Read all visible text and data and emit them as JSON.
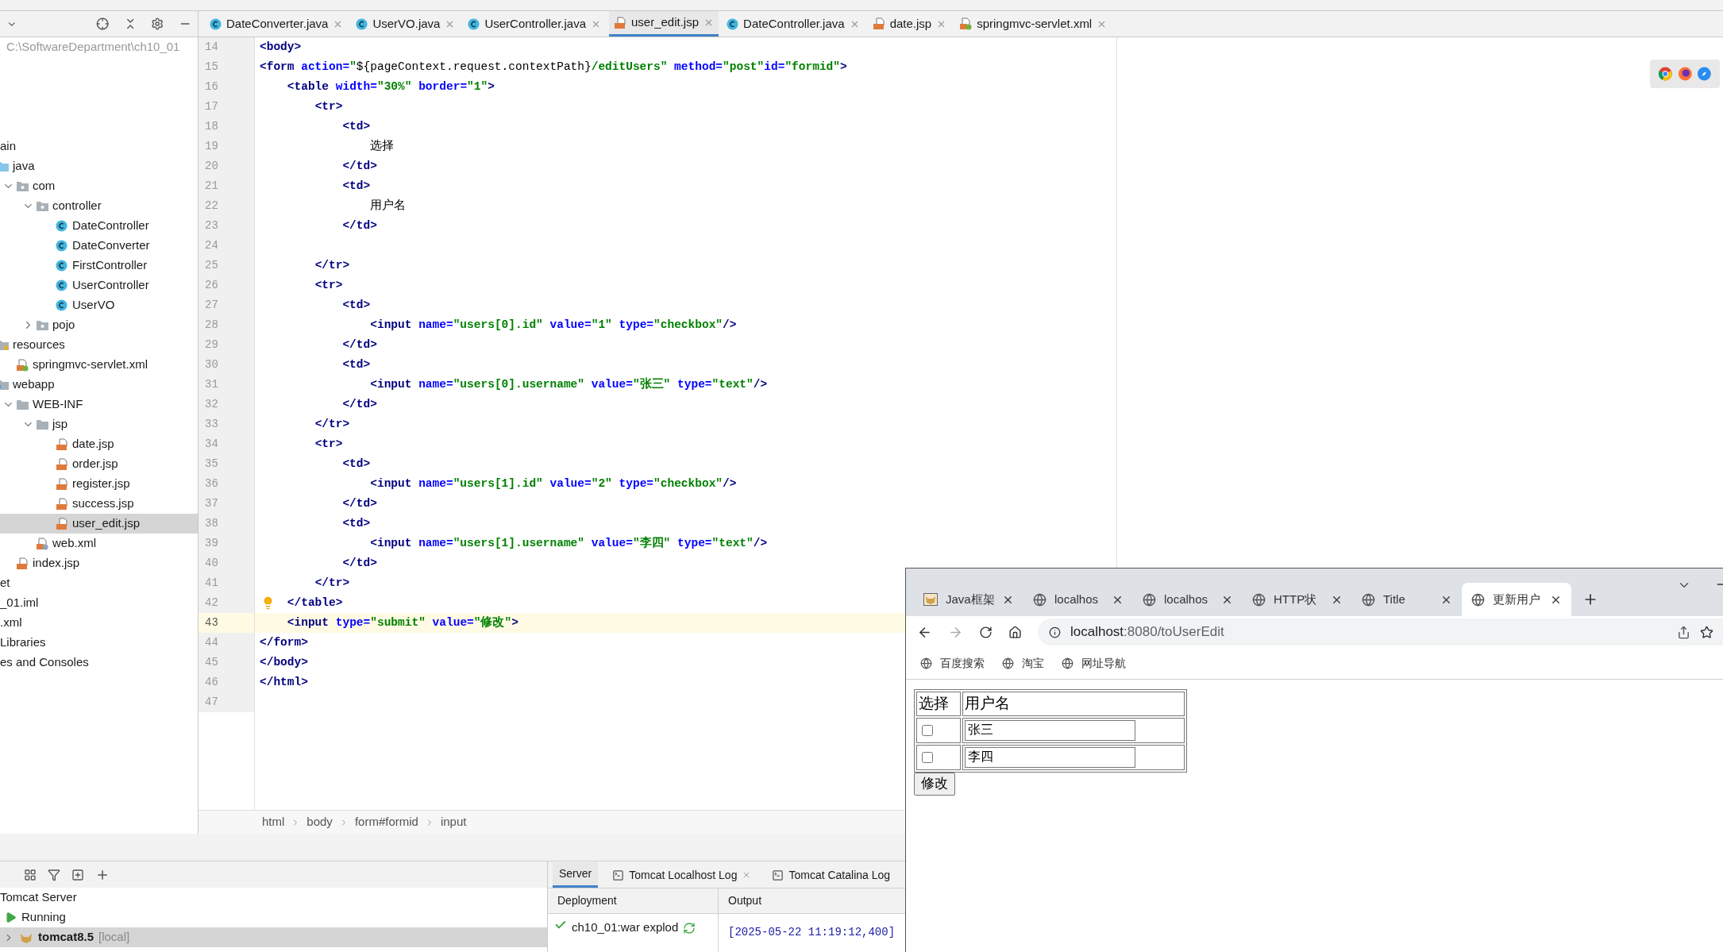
{
  "project": {
    "path": "C:\\SoftwareDepartment\\ch10_01",
    "tree": [
      {
        "label": "ain",
        "selected": false,
        "children": [
          {
            "label": "java",
            "kind": "source-folder",
            "selected": false,
            "children": [
              {
                "label": "com",
                "kind": "package",
                "selected": false,
                "expanded": true,
                "children": [
                  {
                    "label": "controller",
                    "kind": "package",
                    "selected": false,
                    "expanded": true,
                    "children": [
                      {
                        "label": "DateController",
                        "kind": "class",
                        "selected": false
                      },
                      {
                        "label": "DateConverter",
                        "kind": "class",
                        "selected": false
                      },
                      {
                        "label": "FirstController",
                        "kind": "class",
                        "selected": false
                      },
                      {
                        "label": "UserController",
                        "kind": "class",
                        "selected": false
                      },
                      {
                        "label": "UserVO",
                        "kind": "class",
                        "selected": false
                      }
                    ]
                  },
                  {
                    "label": "pojo",
                    "kind": "package",
                    "selected": false,
                    "expanded": false
                  }
                ]
              }
            ]
          },
          {
            "label": "resources",
            "kind": "resources-folder",
            "selected": false,
            "children": [
              {
                "label": "springmvc-servlet.xml",
                "kind": "spring-xml",
                "selected": false
              }
            ]
          },
          {
            "label": "webapp",
            "kind": "web-folder",
            "selected": false,
            "children": [
              {
                "label": "WEB-INF",
                "kind": "folder",
                "selected": false,
                "expanded": true,
                "children": [
                  {
                    "label": "jsp",
                    "kind": "folder",
                    "selected": false,
                    "expanded": true,
                    "children": [
                      {
                        "label": "date.jsp",
                        "kind": "jsp",
                        "selected": false
                      },
                      {
                        "label": "order.jsp",
                        "kind": "jsp",
                        "selected": false
                      },
                      {
                        "label": "register.jsp",
                        "kind": "jsp",
                        "selected": false
                      },
                      {
                        "label": "success.jsp",
                        "kind": "jsp",
                        "selected": false
                      },
                      {
                        "label": "user_edit.jsp",
                        "kind": "jsp",
                        "selected": true
                      }
                    ]
                  },
                  {
                    "label": "web.xml",
                    "kind": "xml",
                    "selected": false
                  }
                ]
              },
              {
                "label": "index.jsp",
                "kind": "jsp",
                "selected": false
              }
            ]
          }
        ]
      },
      {
        "label": "et",
        "selected": false
      },
      {
        "label": "_01.iml",
        "selected": false
      },
      {
        "label": ".xml",
        "selected": false
      },
      {
        "label": "Libraries",
        "selected": false
      },
      {
        "label": "es and Consoles",
        "selected": false
      }
    ]
  },
  "editor_tabs": [
    {
      "label": "DateConverter.java",
      "kind": "class",
      "selected": false
    },
    {
      "label": "UserVO.java",
      "kind": "class",
      "selected": false
    },
    {
      "label": "UserController.java",
      "kind": "class",
      "selected": false
    },
    {
      "label": "user_edit.jsp",
      "kind": "jsp",
      "selected": true
    },
    {
      "label": "DateController.java",
      "kind": "class",
      "selected": false
    },
    {
      "label": "date.jsp",
      "kind": "jsp",
      "selected": false
    },
    {
      "label": "springmvc-servlet.xml",
      "kind": "spring-xml",
      "selected": false
    }
  ],
  "editor": {
    "lines": [
      {
        "n": "14",
        "current": false,
        "bulb": false,
        "tokens": [
          {
            "t": "<body>",
            "kind": "tag"
          }
        ]
      },
      {
        "n": "15",
        "current": false,
        "bulb": false,
        "tokens": [
          {
            "t": "<form",
            "kind": "tag"
          },
          {
            "t": " action=",
            "kind": "attr"
          },
          {
            "t": "\"",
            "kind": "value"
          },
          {
            "t": "${pageContext.request.contextPath}",
            "kind": "plain"
          },
          {
            "t": "/editUsers\"",
            "kind": "value"
          },
          {
            "t": " method=",
            "kind": "attr"
          },
          {
            "t": "\"post\"",
            "kind": "value"
          },
          {
            "t": "id=",
            "kind": "attr"
          },
          {
            "t": "\"formid\"",
            "kind": "value"
          },
          {
            "t": ">",
            "kind": "tag"
          }
        ]
      },
      {
        "n": "16",
        "current": false,
        "bulb": false,
        "tokens": [
          {
            "t": "    <table",
            "kind": "tag"
          },
          {
            "t": " width=",
            "kind": "attr"
          },
          {
            "t": "\"30%\"",
            "kind": "value"
          },
          {
            "t": " border=",
            "kind": "attr"
          },
          {
            "t": "\"1\"",
            "kind": "value"
          },
          {
            "t": ">",
            "kind": "tag"
          }
        ]
      },
      {
        "n": "17",
        "current": false,
        "bulb": false,
        "tokens": [
          {
            "t": "        <tr>",
            "kind": "tag"
          }
        ]
      },
      {
        "n": "18",
        "current": false,
        "bulb": false,
        "tokens": [
          {
            "t": "            <td>",
            "kind": "tag"
          }
        ]
      },
      {
        "n": "19",
        "current": false,
        "bulb": false,
        "tokens": [
          {
            "t": "                选择",
            "kind": "plain"
          }
        ]
      },
      {
        "n": "20",
        "current": false,
        "bulb": false,
        "tokens": [
          {
            "t": "            </td>",
            "kind": "tag"
          }
        ]
      },
      {
        "n": "21",
        "current": false,
        "bulb": false,
        "tokens": [
          {
            "t": "            <td>",
            "kind": "tag"
          }
        ]
      },
      {
        "n": "22",
        "current": false,
        "bulb": false,
        "tokens": [
          {
            "t": "                用户名",
            "kind": "plain"
          }
        ]
      },
      {
        "n": "23",
        "current": false,
        "bulb": false,
        "tokens": [
          {
            "t": "            </td>",
            "kind": "tag"
          }
        ]
      },
      {
        "n": "24",
        "current": false,
        "bulb": false
      },
      {
        "n": "25",
        "current": false,
        "bulb": false,
        "tokens": [
          {
            "t": "        </tr>",
            "kind": "tag"
          }
        ]
      },
      {
        "n": "26",
        "current": false,
        "bulb": false,
        "tokens": [
          {
            "t": "        <tr>",
            "kind": "tag"
          }
        ]
      },
      {
        "n": "27",
        "current": false,
        "bulb": false,
        "tokens": [
          {
            "t": "            <td>",
            "kind": "tag"
          }
        ]
      },
      {
        "n": "28",
        "current": false,
        "bulb": false,
        "tokens": [
          {
            "t": "                <input",
            "kind": "tag"
          },
          {
            "t": " name=",
            "kind": "attr"
          },
          {
            "t": "\"users[0].id\"",
            "kind": "value"
          },
          {
            "t": " value=",
            "kind": "attr"
          },
          {
            "t": "\"1\"",
            "kind": "value"
          },
          {
            "t": " type=",
            "kind": "attr"
          },
          {
            "t": "\"checkbox\"",
            "kind": "value"
          },
          {
            "t": "/>",
            "kind": "tag"
          }
        ]
      },
      {
        "n": "29",
        "current": false,
        "bulb": false,
        "tokens": [
          {
            "t": "            </td>",
            "kind": "tag"
          }
        ]
      },
      {
        "n": "30",
        "current": false,
        "bulb": false,
        "tokens": [
          {
            "t": "            <td>",
            "kind": "tag"
          }
        ]
      },
      {
        "n": "31",
        "current": false,
        "bulb": false,
        "tokens": [
          {
            "t": "                <input",
            "kind": "tag"
          },
          {
            "t": " name=",
            "kind": "attr"
          },
          {
            "t": "\"users[0].username\"",
            "kind": "value"
          },
          {
            "t": " value=",
            "kind": "attr"
          },
          {
            "t": "\"张三\"",
            "kind": "value"
          },
          {
            "t": " type=",
            "kind": "attr"
          },
          {
            "t": "\"text\"",
            "kind": "value"
          },
          {
            "t": "/>",
            "kind": "tag"
          }
        ]
      },
      {
        "n": "32",
        "current": false,
        "bulb": false,
        "tokens": [
          {
            "t": "            </td>",
            "kind": "tag"
          }
        ]
      },
      {
        "n": "33",
        "current": false,
        "bulb": false,
        "tokens": [
          {
            "t": "        </tr>",
            "kind": "tag"
          }
        ]
      },
      {
        "n": "34",
        "current": false,
        "bulb": false,
        "tokens": [
          {
            "t": "        <tr>",
            "kind": "tag"
          }
        ]
      },
      {
        "n": "35",
        "current": false,
        "bulb": false,
        "tokens": [
          {
            "t": "            <td>",
            "kind": "tag"
          }
        ]
      },
      {
        "n": "36",
        "current": false,
        "bulb": false,
        "tokens": [
          {
            "t": "                <input",
            "kind": "tag"
          },
          {
            "t": " name=",
            "kind": "attr"
          },
          {
            "t": "\"users[1].id\"",
            "kind": "value"
          },
          {
            "t": " value=",
            "kind": "attr"
          },
          {
            "t": "\"2\"",
            "kind": "value"
          },
          {
            "t": " type=",
            "kind": "attr"
          },
          {
            "t": "\"checkbox\"",
            "kind": "value"
          },
          {
            "t": "/>",
            "kind": "tag"
          }
        ]
      },
      {
        "n": "37",
        "current": false,
        "bulb": false,
        "tokens": [
          {
            "t": "            </td>",
            "kind": "tag"
          }
        ]
      },
      {
        "n": "38",
        "current": false,
        "bulb": false,
        "tokens": [
          {
            "t": "            <td>",
            "kind": "tag"
          }
        ]
      },
      {
        "n": "39",
        "current": false,
        "bulb": false,
        "tokens": [
          {
            "t": "                <input",
            "kind": "tag"
          },
          {
            "t": " name=",
            "kind": "attr"
          },
          {
            "t": "\"users[1].username\"",
            "kind": "value"
          },
          {
            "t": " value=",
            "kind": "attr"
          },
          {
            "t": "\"李四\"",
            "kind": "value"
          },
          {
            "t": " type=",
            "kind": "attr"
          },
          {
            "t": "\"text\"",
            "kind": "value"
          },
          {
            "t": "/>",
            "kind": "tag"
          }
        ]
      },
      {
        "n": "40",
        "current": false,
        "bulb": false,
        "tokens": [
          {
            "t": "            </td>",
            "kind": "tag"
          }
        ]
      },
      {
        "n": "41",
        "current": false,
        "bulb": false,
        "tokens": [
          {
            "t": "        </tr>",
            "kind": "tag"
          }
        ]
      },
      {
        "n": "42",
        "current": false,
        "bulb": true,
        "tokens": [
          {
            "t": "    </table>",
            "kind": "tag"
          }
        ]
      },
      {
        "n": "43",
        "current": true,
        "bulb": false,
        "tokens": [
          {
            "t": "    <input",
            "kind": "tag"
          },
          {
            "t": " type=",
            "kind": "attr"
          },
          {
            "t": "\"submit\"",
            "kind": "value"
          },
          {
            "t": " value=",
            "kind": "attr"
          },
          {
            "t": "\"修改\"",
            "kind": "value"
          },
          {
            "t": ">",
            "kind": "tag"
          }
        ]
      },
      {
        "n": "44",
        "current": false,
        "bulb": false,
        "tokens": [
          {
            "t": "</form>",
            "kind": "tag"
          }
        ]
      },
      {
        "n": "45",
        "current": false,
        "bulb": false,
        "tokens": [
          {
            "t": "</body>",
            "kind": "tag"
          }
        ]
      },
      {
        "n": "46",
        "current": false,
        "bulb": false,
        "tokens": [
          {
            "t": "</html>",
            "kind": "tag"
          }
        ]
      },
      {
        "n": "47",
        "current": false,
        "bulb": false
      }
    ]
  },
  "breadcrumb": [
    "html",
    "body",
    "form#formid",
    "input"
  ],
  "services": {
    "tree": [
      {
        "label": "Tomcat Server",
        "kind": "group",
        "selected": false
      },
      {
        "label": "Running",
        "kind": "status",
        "selected": false
      },
      {
        "label": "tomcat8.5",
        "note": "[local]",
        "kind": "server",
        "selected": true
      }
    ],
    "tabs": [
      {
        "label": "Server",
        "selected": true,
        "closable": false
      },
      {
        "label": "Tomcat Localhost Log",
        "selected": false,
        "closable": true
      },
      {
        "label": "Tomcat Catalina Log",
        "selected": false,
        "closable": false
      }
    ],
    "columns": [
      "Deployment",
      "Output"
    ],
    "deployment": "ch10_01:war explod",
    "output": "[2025-05-22 11:19:12,400]"
  },
  "browser": {
    "tabs": [
      {
        "label": "Java框架",
        "kind": "tomcat",
        "selected": false
      },
      {
        "label": "localhos",
        "kind": "globe",
        "selected": false
      },
      {
        "label": "localhos",
        "kind": "globe",
        "selected": false
      },
      {
        "label": "HTTP状",
        "kind": "globe",
        "selected": false
      },
      {
        "label": "Title",
        "kind": "globe",
        "selected": false
      },
      {
        "label": "更新用户",
        "kind": "globe",
        "selected": true
      }
    ],
    "url_host": "localhost",
    "url_rest": ":8080/toUserEdit",
    "bookmarks": [
      "百度搜索",
      "淘宝",
      "网址导航"
    ],
    "page": {
      "headers": [
        "选择",
        "用户名"
      ],
      "rows": [
        {
          "checked": false,
          "value": "张三"
        },
        {
          "checked": false,
          "value": "李四"
        }
      ],
      "submit": "修改"
    }
  }
}
